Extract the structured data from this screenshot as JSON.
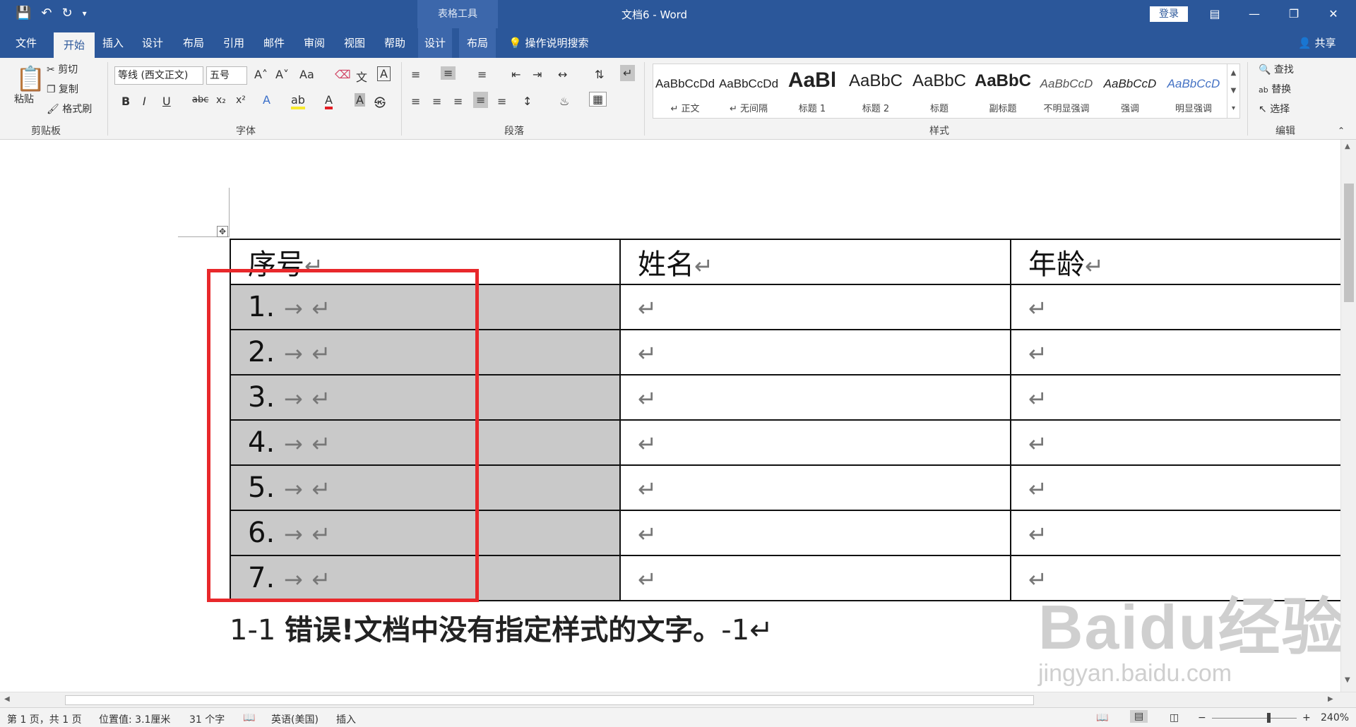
{
  "titlebar": {
    "qat_icons": [
      "save-icon",
      "undo-icon",
      "redo-icon",
      "customize-qat-icon"
    ],
    "context_tab_title": "表格工具",
    "doc_title": "文档6  -  Word",
    "login_label": "登录",
    "window_controls": [
      "ribbon-display-icon",
      "minimize-icon",
      "restore-icon",
      "close-icon"
    ]
  },
  "tabs": {
    "file": "文件",
    "home": "开始",
    "insert": "插入",
    "design": "设计",
    "layout": "布局",
    "references": "引用",
    "mailings": "邮件",
    "review": "审阅",
    "view": "视图",
    "help": "帮助",
    "table_design": "设计",
    "table_layout": "布局",
    "tell_me": "操作说明搜索",
    "share": "共享"
  },
  "ribbon": {
    "clipboard": {
      "label": "剪贴板",
      "paste": "粘贴",
      "cut": "剪切",
      "copy": "复制",
      "format_painter": "格式刷"
    },
    "font": {
      "label": "字体",
      "font_name": "等线 (西文正文)",
      "font_size": "五号"
    },
    "paragraph": {
      "label": "段落"
    },
    "styles": {
      "label": "样式",
      "items": [
        {
          "preview": "AaBbCcDd",
          "name": "↵ 正文"
        },
        {
          "preview": "AaBbCcDd",
          "name": "↵ 无间隔"
        },
        {
          "preview": "AaBl",
          "name": "标题 1"
        },
        {
          "preview": "AaBbC",
          "name": "标题 2"
        },
        {
          "preview": "AaBbC",
          "name": "标题"
        },
        {
          "preview": "AaBbC",
          "name": "副标题"
        },
        {
          "preview": "AaBbCcD",
          "name": "不明显强调"
        },
        {
          "preview": "AaBbCcD",
          "name": "强调"
        },
        {
          "preview": "AaBbCcD",
          "name": "明显强调"
        }
      ]
    },
    "editing": {
      "label": "编辑",
      "find": "查找",
      "replace": "替换",
      "select": "选择"
    }
  },
  "document": {
    "table": {
      "headers": [
        "序号↵",
        "姓名↵",
        "年龄↵"
      ],
      "rows": [
        [
          "1. → ↵",
          "↵",
          "↵"
        ],
        [
          "2. → ↵",
          "↵",
          "↵"
        ],
        [
          "3. → ↵",
          "↵",
          "↵"
        ],
        [
          "4. → ↵",
          "↵",
          "↵"
        ],
        [
          "5. → ↵",
          "↵",
          "↵"
        ],
        [
          "6. → ↵",
          "↵",
          "↵"
        ],
        [
          "7. → ↵",
          "↵",
          "↵"
        ]
      ]
    },
    "caption": {
      "prefix": "1-1 ",
      "error": "错误!文档中没有指定样式的文字。",
      "suffix": "-1↵"
    },
    "watermark": {
      "logo": "Baidu经验",
      "url": "jingyan.baidu.com"
    }
  },
  "statusbar": {
    "page": "第 1 页，共 1 页",
    "position": "位置值: 3.1厘米",
    "words": "31 个字",
    "language": "英语(美国)",
    "mode": "插入",
    "zoom": "240%"
  },
  "colors": {
    "brand": "#2b579a",
    "selection": "#c9c9c9",
    "annotation_box": "#e8282b"
  }
}
